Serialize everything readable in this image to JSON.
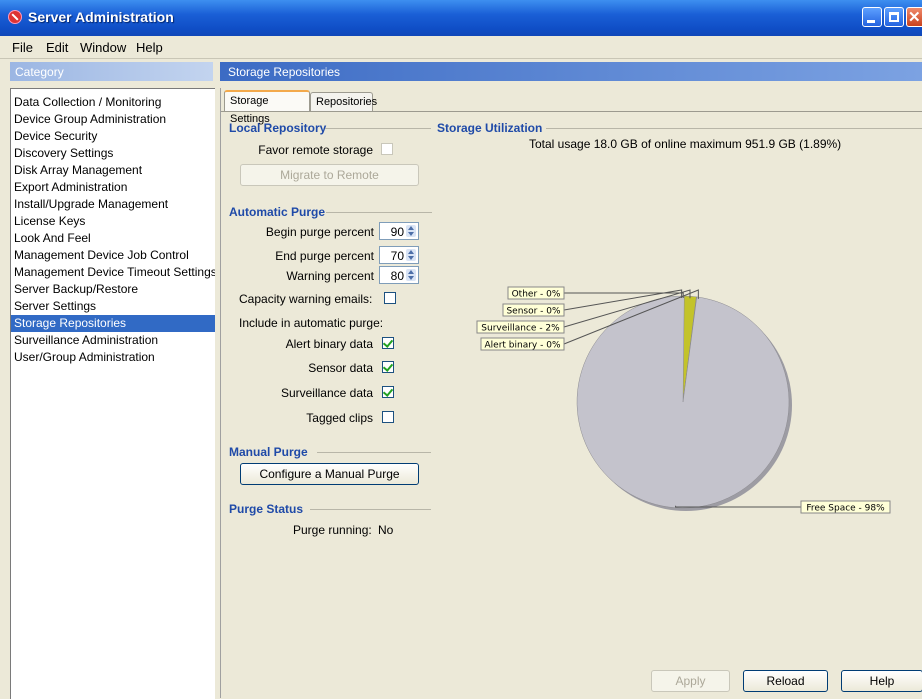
{
  "window": {
    "title": "Server Administration"
  },
  "menu": [
    "File",
    "Edit",
    "Window",
    "Help"
  ],
  "category": {
    "header": "Category",
    "items": [
      "Data Collection / Monitoring",
      "Device Group Administration",
      "Device Security",
      "Discovery Settings",
      "Disk Array Management",
      "Export Administration",
      "Install/Upgrade Management",
      "License Keys",
      "Look And Feel",
      "Management Device Job Control",
      "Management Device Timeout Settings",
      "Server Backup/Restore",
      "Server Settings",
      "Storage Repositories",
      "Surveillance Administration",
      "User/Group Administration"
    ],
    "selected_index": 13
  },
  "main": {
    "header": "Storage Repositories",
    "tabs": [
      "Storage Settings",
      "Repositories"
    ],
    "active_tab": 0
  },
  "local_repository": {
    "title": "Local Repository",
    "favor_remote_label": "Favor remote storage",
    "favor_remote_checked": false,
    "migrate_button": "Migrate to Remote"
  },
  "automatic_purge": {
    "title": "Automatic Purge",
    "begin_label": "Begin purge percent",
    "begin_value": "90",
    "end_label": "End purge percent",
    "end_value": "70",
    "warning_label": "Warning percent",
    "warning_value": "80",
    "capacity_emails_label": "Capacity warning emails:",
    "capacity_emails_checked": false,
    "include_label": "Include in automatic purge:",
    "alert_binary_label": "Alert binary data",
    "alert_binary_checked": true,
    "sensor_label": "Sensor data",
    "sensor_checked": true,
    "surveillance_label": "Surveillance data",
    "surveillance_checked": true,
    "tagged_label": "Tagged clips",
    "tagged_checked": false
  },
  "manual_purge": {
    "title": "Manual Purge",
    "configure_button": "Configure a Manual Purge"
  },
  "purge_status": {
    "title": "Purge Status",
    "running_label": "Purge running:",
    "running_value": "No"
  },
  "storage_utilization": {
    "title": "Storage Utilization",
    "summary": "Total usage 18.0 GB of online maximum 951.9 GB (1.89%)"
  },
  "chart_data": {
    "type": "pie",
    "slices": [
      {
        "label": "Other - 0%",
        "value": 0.0,
        "color": "#cfcf2e"
      },
      {
        "label": "Sensor - 0%",
        "value": 0.0,
        "color": "#cfcf2e"
      },
      {
        "label": "Surveillance - 2%",
        "value": 1.89,
        "color": "#c3c32a"
      },
      {
        "label": "Alert binary - 0%",
        "value": 0.0,
        "color": "#cfcf2e"
      },
      {
        "label": "Free Space - 98%",
        "value": 98.11,
        "color": "#c4c3cc"
      }
    ],
    "legend": "none"
  },
  "footer_buttons": {
    "apply": "Apply",
    "reload": "Reload",
    "help": "Help"
  }
}
